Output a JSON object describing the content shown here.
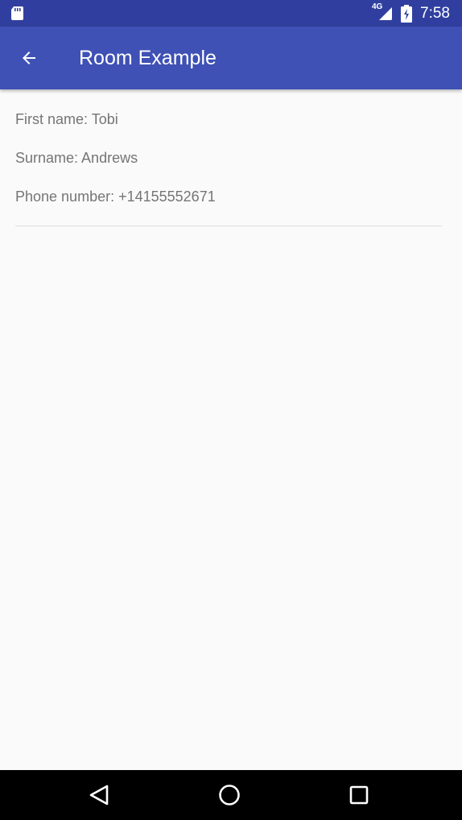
{
  "status_bar": {
    "network_label": "4G",
    "time": "7:58",
    "icons": [
      "sd-card-icon",
      "signal-icon",
      "battery-icon"
    ],
    "background": "#303f9f"
  },
  "app_bar": {
    "title": "Room Example",
    "back_icon": "arrow-back-icon",
    "background": "#3f51b5"
  },
  "contact": {
    "first_name": "First name: Tobi",
    "surname": "Surname: Andrews",
    "phone": "Phone number: +14155552671"
  },
  "nav_bar": {
    "buttons": [
      "back-triangle-icon",
      "home-circle-icon",
      "recents-square-icon"
    ]
  },
  "colors": {
    "text_secondary": "#757575",
    "page_background": "#fafafa"
  }
}
